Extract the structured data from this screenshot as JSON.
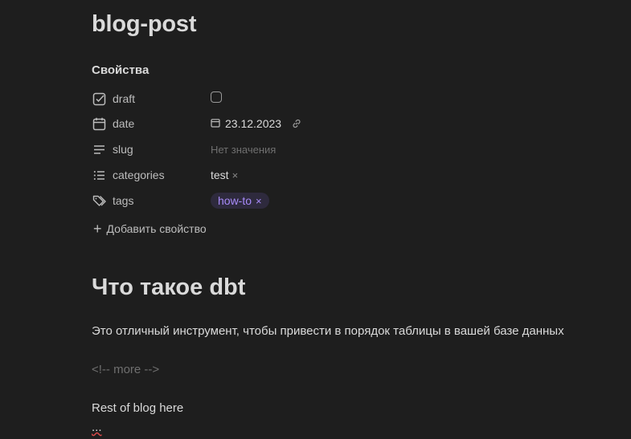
{
  "note": {
    "title": "blog-post"
  },
  "properties": {
    "heading": "Свойства",
    "draft": {
      "key": "draft",
      "icon": "checkbox-icon",
      "checked": false
    },
    "date": {
      "key": "date",
      "icon": "calendar-icon",
      "value": "23.12.2023"
    },
    "slug": {
      "key": "slug",
      "icon": "text-lines-icon",
      "placeholder": "Нет значения"
    },
    "categories": {
      "key": "categories",
      "icon": "list-icon",
      "value": "test",
      "remove": "×"
    },
    "tags": {
      "key": "tags",
      "icon": "tags-icon",
      "value": "how-to",
      "remove": "×"
    },
    "add_label": "Добавить свойство"
  },
  "content": {
    "heading": "Что такое dbt",
    "paragraph": "Это отличный инструмент, чтобы привести в порядок таблицы в вашей базе данных",
    "comment": "<!-- more -->",
    "rest": "Rest of blog here",
    "ellipsis": "..."
  },
  "colors": {
    "background": "#1e1e1e",
    "text": "#dadada",
    "muted": "#6f6f6f",
    "tag_bg": "#2e2a3d",
    "tag_text": "#a88bfa"
  }
}
